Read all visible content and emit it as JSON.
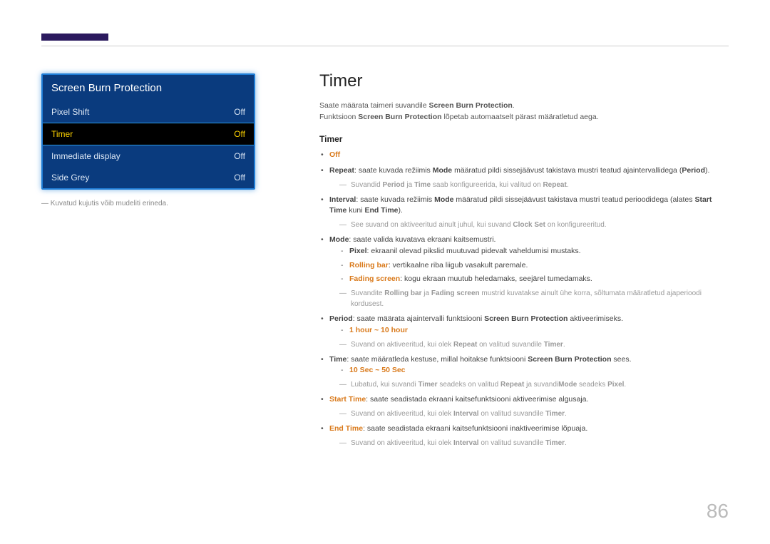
{
  "menu": {
    "title": "Screen Burn Protection",
    "rows": [
      {
        "label": "Pixel Shift",
        "value": "Off"
      },
      {
        "label": "Timer",
        "value": "Off"
      },
      {
        "label": "Immediate display",
        "value": "Off"
      },
      {
        "label": "Side Grey",
        "value": "Off"
      }
    ]
  },
  "footnote": "Kuvatud kujutis võib mudeliti erineda.",
  "heading": "Timer",
  "intro1_a": "Saate määrata taimeri suvandile ",
  "intro1_b": "Screen Burn Protection",
  "intro1_c": ".",
  "intro2_a": "Funktsioon ",
  "intro2_b": "Screen Burn Protection",
  "intro2_c": " lõpetab automaatselt pärast määratletud aega.",
  "sub_heading": "Timer",
  "off_label": "Off",
  "repeat_a": "Repeat",
  "repeat_b": ": saate kuvada režiimis ",
  "repeat_c": "Mode",
  "repeat_d": " määratud pildi sissejäävust takistava mustri teatud ajaintervallidega (",
  "repeat_e": "Period",
  "repeat_f": ").",
  "note1_a": "Suvandid ",
  "note1_b": "Period",
  "note1_c": " ja ",
  "note1_d": "Time",
  "note1_e": " saab konfigureerida, kui valitud on ",
  "note1_f": "Repeat",
  "note1_g": ".",
  "interval_a": "Interval",
  "interval_b": ": saate kuvada režiimis ",
  "interval_c": "Mode",
  "interval_d": " määratud pildi sissejäävust takistava mustri teatud perioodidega (alates ",
  "interval_e": "Start Time",
  "interval_f": " kuni ",
  "interval_g": "End Time",
  "interval_h": ").",
  "note2_a": "See suvand on aktiveeritud ainult juhul, kui suvand ",
  "note2_b": "Clock Set",
  "note2_c": " on konfigureeritud.",
  "mode_a": "Mode",
  "mode_b": ": saate valida kuvatava ekraani kaitsemustri.",
  "pixel_a": "Pixel",
  "pixel_b": ": ekraanil olevad pikslid muutuvad pidevalt vaheldumisi mustaks.",
  "rolling_a": "Rolling bar",
  "rolling_b": ": vertikaalne riba liigub vasakult paremale.",
  "fading_a": "Fading screen",
  "fading_b": ": kogu ekraan muutub heledamaks, seejärel tumedamaks.",
  "note3_a": "Suvandite ",
  "note3_b": "Rolling bar",
  "note3_c": " ja ",
  "note3_d": "Fading screen",
  "note3_e": " mustrid kuvatakse ainult ühe korra, sõltumata määratletud ajaperioodi kordusest.",
  "period_a": "Period",
  "period_b": ": saate määrata ajaintervalli funktsiooni ",
  "period_c": "Screen Burn Protection",
  "period_d": " aktiveerimiseks.",
  "period_range": "1 hour ~ 10 hour",
  "note4_a": "Suvand on aktiveeritud, kui olek ",
  "note4_b": "Repeat",
  "note4_c": " on valitud suvandile ",
  "note4_d": "Timer",
  "note4_e": ".",
  "time_a": "Time",
  "time_b": ": saate määratleda kestuse, millal hoitakse funktsiooni ",
  "time_c": "Screen Burn Protection",
  "time_d": " sees.",
  "time_range": "10 Sec ~ 50 Sec",
  "note5_a": "Lubatud, kui suvandi ",
  "note5_b": "Timer",
  "note5_c": " seadeks on valitud ",
  "note5_d": "Repeat",
  "note5_e": " ja suvandi",
  "note5_f": "Mode",
  "note5_g": " seadeks ",
  "note5_h": "Pixel",
  "note5_i": ".",
  "start_a": "Start Time",
  "start_b": ": saate seadistada ekraani kaitsefunktsiooni aktiveerimise algusaja.",
  "note6_a": "Suvand on aktiveeritud, kui olek ",
  "note6_b": "Interval",
  "note6_c": " on valitud suvandile ",
  "note6_d": "Timer",
  "note6_e": ".",
  "end_a": "End Time",
  "end_b": ": saate seadistada ekraani kaitsefunktsiooni inaktiveerimise lõpuaja.",
  "note7_a": "Suvand on aktiveeritud, kui olek ",
  "note7_b": "Interval",
  "note7_c": " on valitud suvandile ",
  "note7_d": "Timer",
  "note7_e": ".",
  "page_number": "86"
}
